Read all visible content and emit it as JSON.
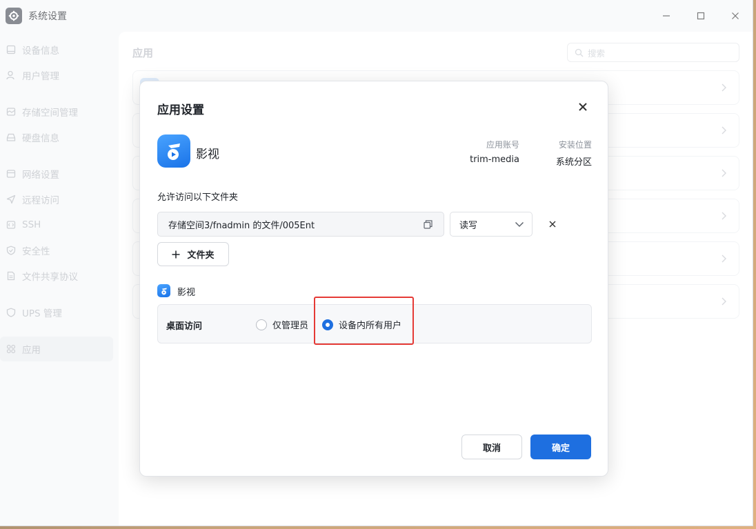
{
  "window": {
    "title": "系统设置",
    "icon": "gear-icon"
  },
  "sidebar": {
    "items": [
      {
        "label": "设备信息",
        "icon": "monitor-icon"
      },
      {
        "label": "用户管理",
        "icon": "user-icon"
      },
      {
        "label": "存储空间管理",
        "icon": "storage-icon"
      },
      {
        "label": "硬盘信息",
        "icon": "disk-icon"
      },
      {
        "label": "网络设置",
        "icon": "network-icon"
      },
      {
        "label": "远程访问",
        "icon": "send-icon"
      },
      {
        "label": "SSH",
        "icon": "code-icon"
      },
      {
        "label": "安全性",
        "icon": "shield-icon"
      },
      {
        "label": "文件共享协议",
        "icon": "file-icon"
      },
      {
        "label": "UPS 管理",
        "icon": "ups-shield-icon"
      },
      {
        "label": "应用",
        "icon": "apps-grid-icon",
        "active": true
      }
    ]
  },
  "main": {
    "title": "应用",
    "search": {
      "placeholder": "搜索"
    }
  },
  "dialog": {
    "title": "应用设置",
    "app": {
      "name": "影视",
      "account_label": "应用账号",
      "account_value": "trim-media",
      "location_label": "安装位置",
      "location_value": "系统分区"
    },
    "folders_label": "允许访问以下文件夹",
    "folder_rows": [
      {
        "path": "存储空间3/fnadmin 的文件/005Ent",
        "permission": "读写"
      }
    ],
    "add_folder_label": "文件夹",
    "desktop": {
      "app_name": "影视",
      "access_label": "桌面访问",
      "options": [
        {
          "label": "仅管理员",
          "selected": false
        },
        {
          "label": "设备内所有用户",
          "selected": true
        }
      ]
    },
    "cancel_label": "取消",
    "ok_label": "确定"
  },
  "colors": {
    "accent": "#1e6fe0",
    "highlight": "#e53935"
  }
}
